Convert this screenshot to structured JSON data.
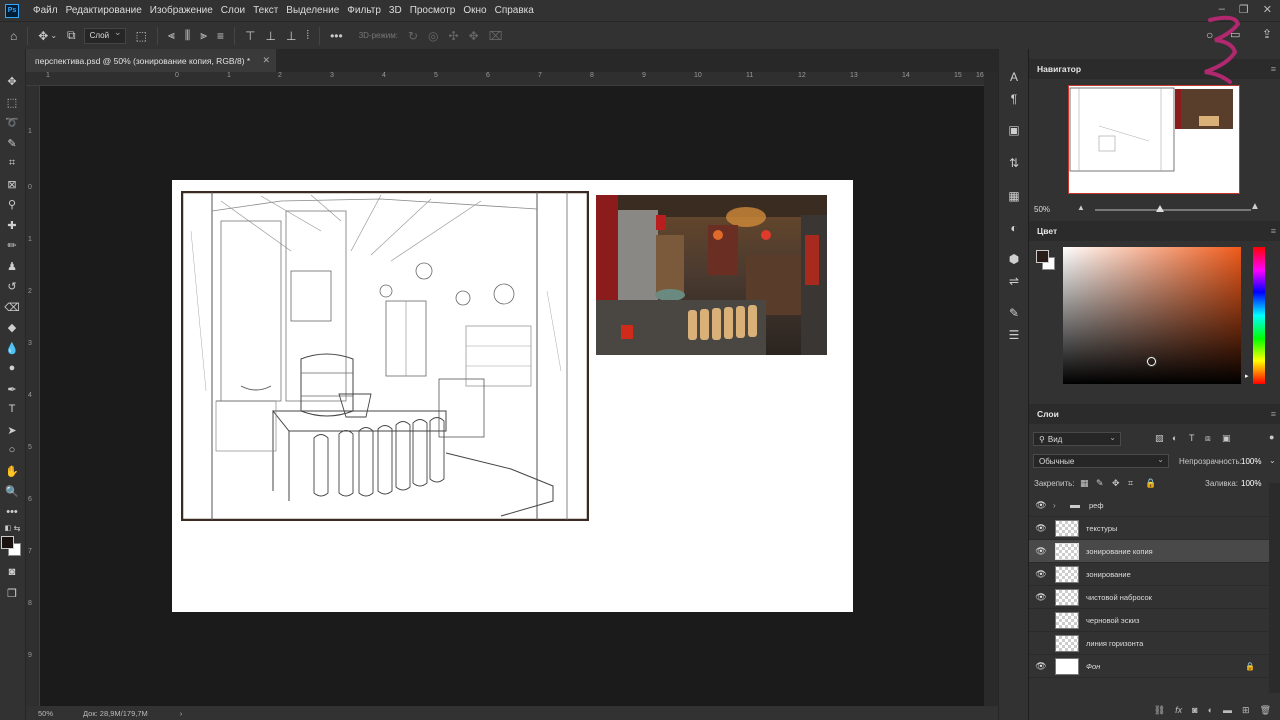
{
  "menu": {
    "logo": "Ps",
    "items": [
      "Файл",
      "Редактирование",
      "Изображение",
      "Слои",
      "Текст",
      "Выделение",
      "Фильтр",
      "3D",
      "Просмотр",
      "Окно",
      "Справка"
    ]
  },
  "options": {
    "layer_select": "Слой",
    "mode_3d": "3D-режим:"
  },
  "document_tab": {
    "title": "перспектива.psd @ 50% (зонирование копия, RGB/8) *"
  },
  "rulers": {
    "top": [
      "1",
      "0",
      "1",
      "2",
      "3",
      "4",
      "5",
      "6",
      "7",
      "8",
      "9",
      "10",
      "11",
      "12",
      "13",
      "14",
      "15",
      "16"
    ],
    "left": [
      "1",
      "0",
      "1",
      "2",
      "3",
      "4",
      "5",
      "6",
      "7",
      "8",
      "9"
    ]
  },
  "status": {
    "zoom": "50%",
    "doc_info": "Док: 28,9M/179,7M"
  },
  "navigator": {
    "title": "Навигатор",
    "zoom": "50%"
  },
  "color_panel": {
    "title": "Цвет",
    "foreground": "#2a1c18",
    "background": "#ffffff",
    "hue": "#f05a1a"
  },
  "layers_panel": {
    "title": "Слои",
    "filter_label": "Вид",
    "blend_mode": "Обычные",
    "opacity_label": "Непрозрачность:",
    "opacity_value": "100%",
    "lock_label": "Закрепить:",
    "fill_label": "Заливка:",
    "fill_value": "100%",
    "layers": [
      {
        "name": "реф",
        "visible": true,
        "type": "folder"
      },
      {
        "name": "текстуры",
        "visible": true,
        "type": "layer"
      },
      {
        "name": "зонирование копия",
        "visible": true,
        "type": "layer",
        "active": true
      },
      {
        "name": "зонирование",
        "visible": true,
        "type": "layer"
      },
      {
        "name": "чистовой набросок",
        "visible": true,
        "type": "layer"
      },
      {
        "name": "черновой эскиз",
        "visible": false,
        "type": "layer"
      },
      {
        "name": "линия горизонта",
        "visible": false,
        "type": "layer"
      },
      {
        "name": "Фон",
        "visible": true,
        "type": "background",
        "locked": true
      }
    ]
  }
}
